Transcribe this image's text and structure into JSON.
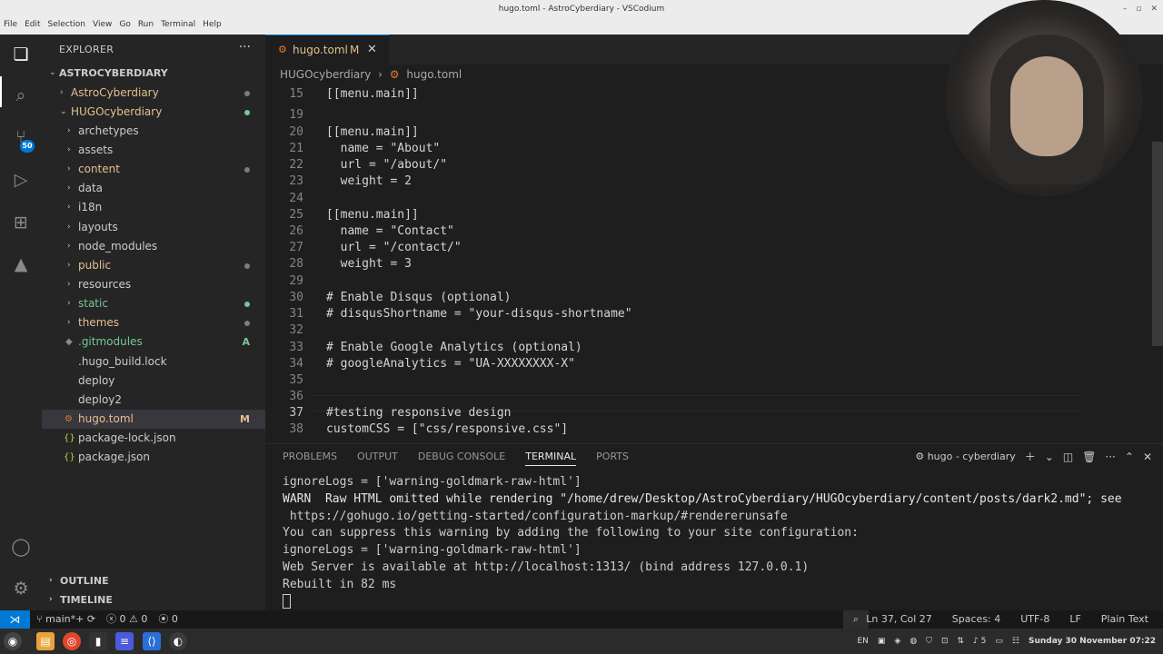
{
  "window": {
    "title": "hugo.toml - AstroCyberdiary - VSCodium",
    "menu": [
      "File",
      "Edit",
      "Selection",
      "View",
      "Go",
      "Run",
      "Terminal",
      "Help"
    ]
  },
  "activity_bar": {
    "scm_badge": "50"
  },
  "sidebar": {
    "title": "EXPLORER",
    "root": "ASTROCYBERDIARY",
    "items": [
      {
        "label": "AstroCyberdiary",
        "status": "dot"
      },
      {
        "label": "HUGOcyberdiary",
        "status": "dot"
      },
      {
        "label": "archetypes",
        "status": ""
      },
      {
        "label": "assets",
        "status": ""
      },
      {
        "label": "content",
        "status": "dot"
      },
      {
        "label": "data",
        "status": ""
      },
      {
        "label": "i18n",
        "status": ""
      },
      {
        "label": "layouts",
        "status": ""
      },
      {
        "label": "node_modules",
        "status": ""
      },
      {
        "label": "public",
        "status": "dot"
      },
      {
        "label": "resources",
        "status": ""
      },
      {
        "label": "static",
        "status": "dot"
      },
      {
        "label": "themes",
        "status": "dot"
      },
      {
        "label": ".gitmodules",
        "status": "A"
      },
      {
        "label": ".hugo_build.lock",
        "status": ""
      },
      {
        "label": "deploy",
        "status": ""
      },
      {
        "label": "deploy2",
        "status": ""
      },
      {
        "label": "hugo.toml",
        "status": "M"
      },
      {
        "label": "package-lock.json",
        "status": ""
      },
      {
        "label": "package.json",
        "status": ""
      }
    ],
    "outline": "OUTLINE",
    "timeline": "TIMELINE"
  },
  "editor": {
    "tab_label": "hugo.toml",
    "tab_modified": "M",
    "breadcrumb": [
      "HUGOcyberdiary",
      "hugo.toml"
    ],
    "lines": [
      {
        "n": "15",
        "t": "[[menu.main]]"
      },
      {
        "n": "19",
        "t": ""
      },
      {
        "n": "20",
        "t": "[[menu.main]]"
      },
      {
        "n": "21",
        "t": "  name = \"About\""
      },
      {
        "n": "22",
        "t": "  url = \"/about/\""
      },
      {
        "n": "23",
        "t": "  weight = 2"
      },
      {
        "n": "24",
        "t": ""
      },
      {
        "n": "25",
        "t": "[[menu.main]]"
      },
      {
        "n": "26",
        "t": "  name = \"Contact\""
      },
      {
        "n": "27",
        "t": "  url = \"/contact/\""
      },
      {
        "n": "28",
        "t": "  weight = 3"
      },
      {
        "n": "29",
        "t": ""
      },
      {
        "n": "30",
        "t": "# Enable Disqus (optional)"
      },
      {
        "n": "31",
        "t": "# disqusShortname = \"your-disqus-shortname\""
      },
      {
        "n": "32",
        "t": ""
      },
      {
        "n": "33",
        "t": "# Enable Google Analytics (optional)"
      },
      {
        "n": "34",
        "t": "# googleAnalytics = \"UA-XXXXXXXX-X\""
      },
      {
        "n": "35",
        "t": ""
      },
      {
        "n": "36",
        "t": ""
      },
      {
        "n": "37",
        "t": "#testing responsive design"
      },
      {
        "n": "38",
        "t": "customCSS = [\"css/responsive.css\"]"
      }
    ]
  },
  "panel": {
    "tabs": [
      "PROBLEMS",
      "OUTPUT",
      "DEBUG CONSOLE",
      "TERMINAL",
      "PORTS"
    ],
    "terminal_name": "hugo - cyberdiary",
    "terminal_lines": [
      "ignoreLogs = ['warning-goldmark-raw-html']",
      "WARN  Raw HTML omitted while rendering \"/home/drew/Desktop/AstroCyberdiary/HUGOcyberdiary/content/posts/dark2.md\"; see",
      " https://gohugo.io/getting-started/configuration-markup/#rendererunsafe",
      "You can suppress this warning by adding the following to your site configuration:",
      "ignoreLogs = ['warning-goldmark-raw-html']",
      "Web Server is available at http://localhost:1313/ (bind address 127.0.0.1)",
      "Rebuilt in 82 ms"
    ]
  },
  "statusbar": {
    "branch": "main*+",
    "errors": "0",
    "warnings": "0",
    "ports": "0",
    "position": "Ln 37, Col 27",
    "spaces": "Spaces: 4",
    "encoding": "UTF-8",
    "eol": "LF",
    "language": "Plain Text"
  },
  "taskbar": {
    "lang": "EN",
    "clock": "Sunday 30 November 07:22",
    "volume": "5"
  }
}
